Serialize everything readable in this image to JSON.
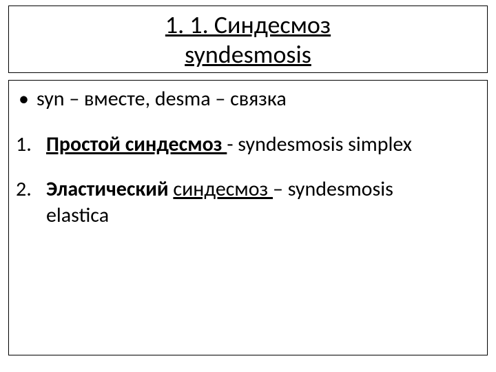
{
  "title": {
    "line1": "1. 1.  Синдесмоз",
    "line2": "syndesmosis"
  },
  "etymology": {
    "bullet": "•",
    "text_html": "syn – вместе,  desma – связка"
  },
  "items": [
    {
      "num": "1.",
      "underlined_bold": "Простой  синдесмоз ",
      "rest": "-  syndesmosis simplex"
    },
    {
      "num": "2.",
      "bold_part": "Эластический ",
      "underlined_part": "синдесмоз ",
      "rest_line1": "– syndesmosis",
      "rest_line2": "elastica"
    }
  ]
}
